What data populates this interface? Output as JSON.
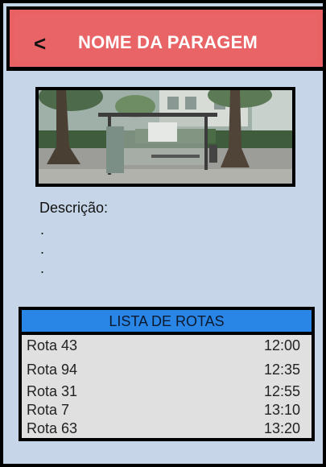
{
  "header": {
    "back_label": "<",
    "title": "NOME DA PARAGEM",
    "color": "#ea6163"
  },
  "stop_photo": {
    "description": "bus stop shelter photo"
  },
  "description": {
    "label": "Descrição:",
    "lines": [
      ".",
      ".",
      "."
    ]
  },
  "routes": {
    "header": "LISTA DE ROTAS",
    "header_color": "#2a86e6",
    "items": [
      {
        "name": "Rota 43",
        "time": "12:00"
      },
      {
        "name": "Rota 94",
        "time": "12:35"
      },
      {
        "name": "Rota 31",
        "time": "12:55"
      },
      {
        "name": "Rota 7",
        "time": "13:10"
      },
      {
        "name": "Rota 63",
        "time": "13:20"
      }
    ]
  }
}
